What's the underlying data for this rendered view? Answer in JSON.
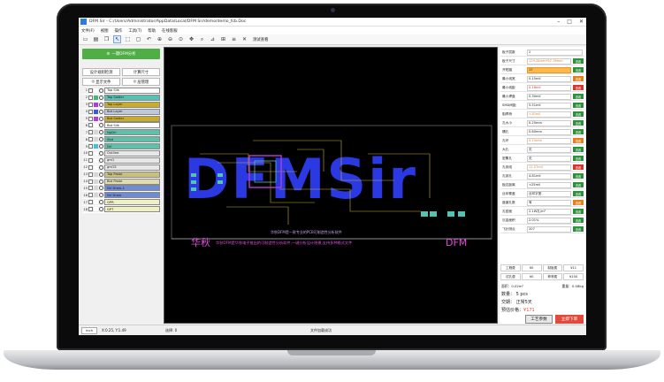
{
  "window": {
    "title": "DFM Sir - C:/Users/Administrator/AppData/Local/DFM Sir/demo/demo_fcb.Doc"
  },
  "menu": [
    "文件(F)",
    "视图",
    "操作",
    "工具(T)",
    "帮助",
    "在线客服"
  ],
  "toolbar": {
    "icons": [
      "open-icon",
      "print-icon",
      "copy-icon",
      "cursor-icon",
      "select-icon",
      "rectangle-icon",
      "undo-icon",
      "zoom-in-icon",
      "zoom-out-icon",
      "zoom-fit-icon",
      "pan-icon",
      "search-icon",
      "measure-icon",
      "ruler-icon",
      "layer-icon",
      "cross-icon"
    ],
    "label": "测试查看"
  },
  "left_panel": {
    "main_button": "一键DFM分析",
    "btn_a": "设计规则检测",
    "btn_b": "计算尺寸",
    "btn_c": "显示文件",
    "btn_d": "层管理",
    "layers": [
      {
        "num": "1",
        "name": "Top Silk",
        "color": "#ffffff",
        "swatch": "#ffffff"
      },
      {
        "num": "2",
        "name": "Top Solder",
        "color": "#53c3b4",
        "swatch": "#46b57a"
      },
      {
        "num": "3",
        "name": "Top Layer",
        "color": "#c9ad2a",
        "swatch": "#b23fd3"
      },
      {
        "num": "4",
        "name": "Bot Layer",
        "color": "#c0c7d8",
        "swatch": "#3c5bd8"
      },
      {
        "num": "5",
        "name": "Bot Solder",
        "color": "#c9ad2a",
        "swatch": "#b23fd3"
      },
      {
        "num": "6",
        "name": "Bot Silk",
        "color": "#ffffff",
        "swatch": "#ffffff"
      },
      {
        "num": "7",
        "name": "NpDrl",
        "color": "#5ec0a8",
        "swatch": "#d7d7d7"
      },
      {
        "num": "8",
        "name": "Slot",
        "color": "#5ec0a8",
        "swatch": "#d7d7d7"
      },
      {
        "num": "9",
        "name": "Drl",
        "color": "#5ec0a8",
        "swatch": "#46c0d8"
      },
      {
        "num": "10",
        "name": "Outline",
        "color": "#e7e7e7",
        "swatch": "#ffffff"
      },
      {
        "num": "11",
        "name": "gm1",
        "color": "#e7e7e7",
        "swatch": "#ffffff"
      },
      {
        "num": "12",
        "name": "gm15",
        "color": "#e7e7e7",
        "swatch": "#ffffff"
      },
      {
        "num": "13",
        "name": "Top Paste",
        "color": "#c9c07a",
        "swatch": "#d7d7d7"
      },
      {
        "num": "14",
        "name": "Bot Paste",
        "color": "#e0dcae",
        "swatch": "#d7d7d7"
      },
      {
        "num": "15",
        "name": "Drl Draw-1",
        "color": "#6f8bd6",
        "swatch": "#d7d7d7"
      },
      {
        "num": "16",
        "name": "Drl Draw",
        "color": "#6f8bd6",
        "swatch": "#d7d7d7"
      },
      {
        "num": "17",
        "name": "GPR",
        "color": "#f1efc4",
        "swatch": "#ffffff"
      },
      {
        "num": "18",
        "name": "GPT",
        "color": "#f1efc4",
        "swatch": "#ffffff"
      }
    ]
  },
  "right_panel": {
    "props": [
      {
        "label": "板子层数",
        "value": "2",
        "hl": false,
        "badge": ""
      },
      {
        "label": "板子尺寸",
        "value": "129.28mm*57.78mm",
        "hl": false,
        "badge": "查看"
      },
      {
        "label": "开短路",
        "value": "17",
        "hl": true,
        "badge": "查看"
      },
      {
        "label": "最小线宽",
        "value": "0.15mil",
        "hl": false,
        "badge": "查看"
      },
      {
        "label": "最小线距",
        "value": "0.16mil",
        "hl": false,
        "badge": "查看"
      },
      {
        "label": "最小焊盘",
        "value": "0.30mil",
        "hl": false,
        "badge": "查看"
      },
      {
        "label": "SMD间距",
        "value": "5.51mil",
        "hl": false,
        "badge": "查看"
      },
      {
        "label": "阻焊桥",
        "value": "<10mil",
        "hl": false,
        "badge": "查看"
      },
      {
        "label": "孔大小",
        "value": "0.25mm",
        "hl": false,
        "badge": "查看"
      },
      {
        "label": "槽孔",
        "value": "0.60mm",
        "hl": false,
        "badge": "查看"
      },
      {
        "label": "孔环",
        "value": "0.15mm",
        "hl": false,
        "badge": "查看"
      },
      {
        "label": "大孔",
        "value": "无",
        "hl": false,
        "badge": "查看"
      },
      {
        "label": "密集孔",
        "value": "无",
        "hl": false,
        "badge": "查看"
      },
      {
        "label": "孔到线",
        "value": "11.57mil",
        "hl": false,
        "badge": "查看"
      },
      {
        "label": "孔到孔",
        "value": "4.81mil",
        "hl": false,
        "badge": "查看"
      },
      {
        "label": "板边距离",
        "value": "<25mil",
        "hl": false,
        "badge": "查看"
      },
      {
        "label": "丝印覆盖",
        "value": "丝印字宽",
        "hl": false,
        "badge": "查看"
      },
      {
        "label": "盘镀孔数",
        "value": "有",
        "hl": false,
        "badge": "查看"
      },
      {
        "label": "孔密度",
        "value": "2.1W孔/m²",
        "hl": false,
        "badge": "查看"
      },
      {
        "label": "沉金面积",
        "value": "2.01%",
        "hl": false,
        "badge": "查看"
      },
      {
        "label": "飞针测点",
        "value": "207",
        "hl": false,
        "badge": "查看"
      }
    ],
    "costs": [
      [
        "工程费",
        "¥0",
        "制板费",
        "¥11"
      ],
      [
        "试孔费",
        "¥0",
        "菲林费",
        "¥100"
      ]
    ],
    "area": "面积：0.02m²",
    "weight": "重量：0.08kg",
    "quantity": "数量： 5 pcs",
    "delivery": "交期：  正常5天",
    "price_label": "预估价格：",
    "price": "¥171",
    "btn_params": "工艺参数",
    "btn_order": "立即下单"
  },
  "canvas": {
    "brand_text": "DFMSir",
    "label_left": "华秋",
    "label_right": "DFM",
    "subtitle_lines": [
      "华秋DFM是一款专业的PCB可制造性分析软件",
      "华秋DFM是华秋电子推出的可制造性分析软件,一键分析设计隐患,支持多种格式文件"
    ]
  },
  "status": {
    "unit": "inch",
    "coords": "X:0.25, Y:1.49",
    "selected": "选择: 0",
    "message": "文件加载成功"
  },
  "colors": {
    "green": "#4fae44",
    "red": "#e24a3b",
    "orange": "#ffb84d",
    "blue_layer": "#2b39e3",
    "pink_text": "#e04fd9"
  }
}
